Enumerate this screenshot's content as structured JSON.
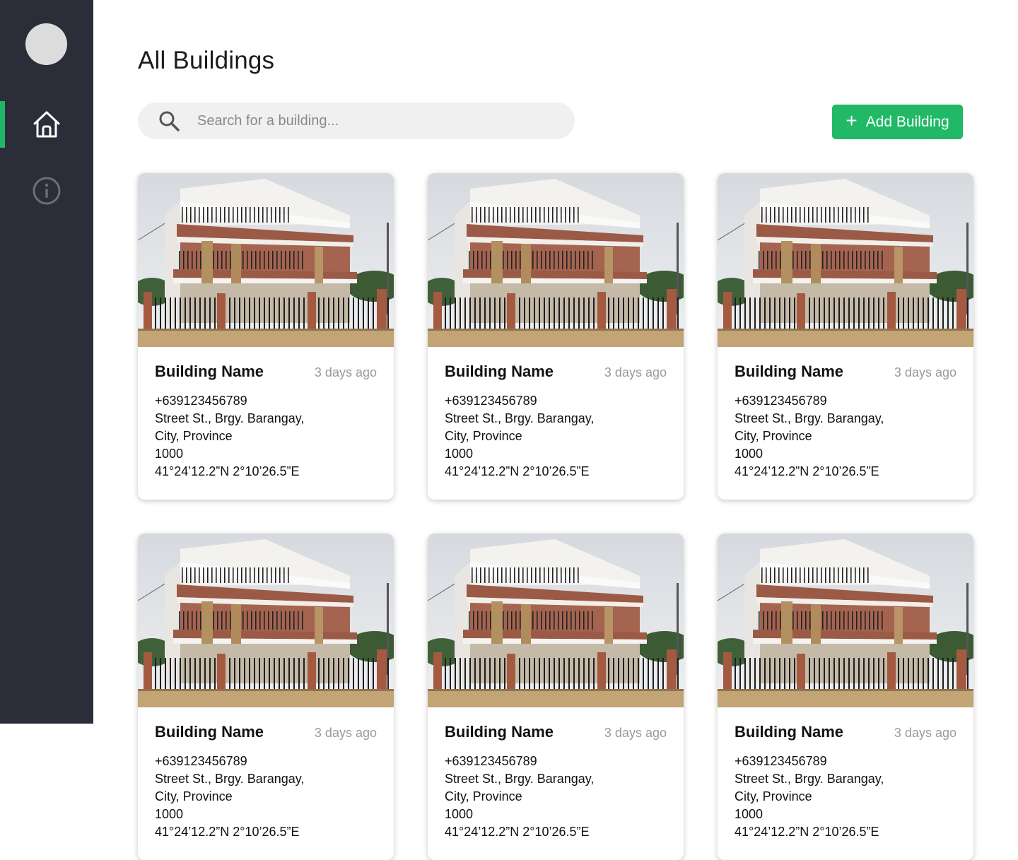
{
  "sidebar": {
    "nav": [
      {
        "name": "home",
        "icon": "home-icon",
        "active": true
      },
      {
        "name": "info",
        "icon": "info-icon",
        "active": false
      }
    ],
    "accent_color": "#22b766"
  },
  "header": {
    "title": "All Buildings"
  },
  "search": {
    "placeholder": "Search for a building...",
    "value": ""
  },
  "toolbar": {
    "add_label": "Add Building",
    "add_icon": "plus-icon",
    "add_color": "#21b966"
  },
  "cards": [
    {
      "name": "Building Name",
      "time": "3 days ago",
      "phone": "+639123456789",
      "street": "Street St., Brgy. Barangay,",
      "city": "City, Province",
      "zip": "1000",
      "coords": "41°24’12.2”N 2°10’26.5”E"
    },
    {
      "name": "Building Name",
      "time": "3 days ago",
      "phone": "+639123456789",
      "street": "Street St., Brgy. Barangay,",
      "city": "City, Province",
      "zip": "1000",
      "coords": "41°24’12.2”N 2°10’26.5”E"
    },
    {
      "name": "Building Name",
      "time": "3 days ago",
      "phone": "+639123456789",
      "street": "Street St., Brgy. Barangay,",
      "city": "City, Province",
      "zip": "1000",
      "coords": "41°24’12.2”N 2°10’26.5”E"
    },
    {
      "name": "Building Name",
      "time": "3 days ago",
      "phone": "+639123456789",
      "street": "Street St., Brgy. Barangay,",
      "city": "City, Province",
      "zip": "1000",
      "coords": "41°24’12.2”N 2°10’26.5”E"
    },
    {
      "name": "Building Name",
      "time": "3 days ago",
      "phone": "+639123456789",
      "street": "Street St., Brgy. Barangay,",
      "city": "City, Province",
      "zip": "1000",
      "coords": "41°24’12.2”N 2°10’26.5”E"
    },
    {
      "name": "Building Name",
      "time": "3 days ago",
      "phone": "+639123456789",
      "street": "Street St., Brgy. Barangay,",
      "city": "City, Province",
      "zip": "1000",
      "coords": "41°24’12.2”N 2°10’26.5”E"
    }
  ]
}
